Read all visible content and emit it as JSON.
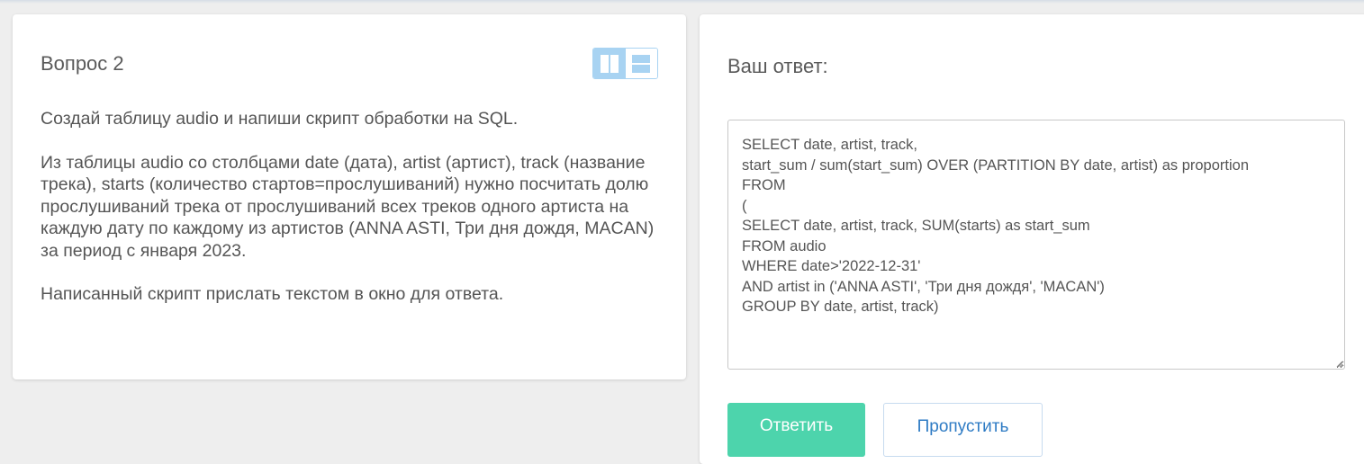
{
  "question": {
    "title": "Вопрос 2",
    "paragraphs": [
      "Создай таблицу audio и напиши скрипт обработки на SQL.",
      "Из таблицы audio со столбцами date (дата), artist (артист), track (название трека), starts (количество стартов=прослушиваний) нужно посчитать долю прослушиваний трека от прослушиваний всех треков одного артиста на каждую дату по каждому из артистов (ANNA ASTI, Три дня дождя, MACAN) за период с января 2023.",
      "Написанный скрипт прислать текстом в окно для ответа."
    ],
    "layout_toggle": {
      "columns_icon": "columns-icon",
      "rows_icon": "rows-icon",
      "active": "columns"
    }
  },
  "answer": {
    "title": "Ваш ответ:",
    "value": "SELECT date, artist, track,\nstart_sum / sum(start_sum) OVER (PARTITION BY date, artist) as proportion\nFROM\n(\nSELECT date, artist, track, SUM(starts) as start_sum\nFROM audio\nWHERE date>'2022-12-31'\nAND artist in ('ANNA ASTI', 'Три дня дождя', 'MACAN')\nGROUP BY date, artist, track)",
    "submit_label": "Ответить",
    "skip_label": "Пропустить"
  },
  "colors": {
    "accent": "#4dd4ac",
    "link": "#2e7bc4",
    "toggle_active": "#a8d3f2"
  }
}
